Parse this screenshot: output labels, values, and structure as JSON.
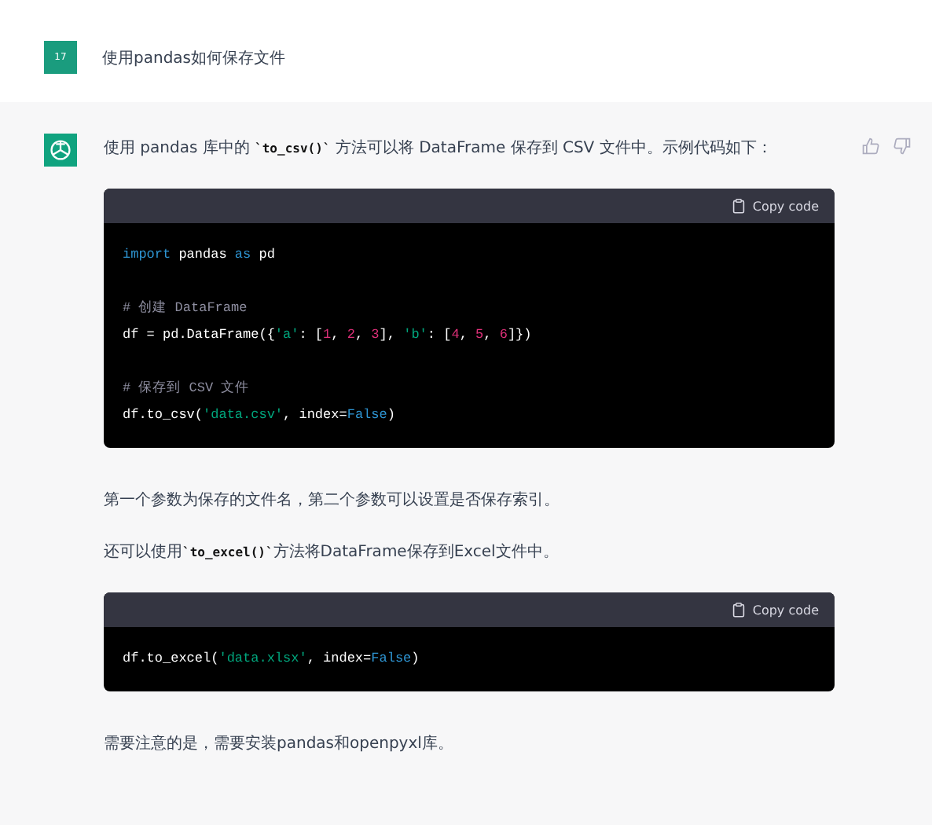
{
  "user_message": {
    "avatar": "17",
    "text": "使用pandas如何保存文件"
  },
  "answer": {
    "blocks": [
      {
        "kind": "paragraph",
        "segments": [
          {
            "kind": "text",
            "text": "使用 pandas 库中的 "
          },
          {
            "kind": "code",
            "text": "`to_csv()`"
          },
          {
            "kind": "text",
            "text": " 方法可以将 DataFrame 保存到 CSV 文件中。示例代码如下："
          }
        ]
      },
      {
        "kind": "code",
        "button": "Copy code",
        "groups": [
          [
            [
              {
                "kind": "keyword",
                "text": "import"
              },
              {
                "kind": "plain",
                "text": " pandas "
              },
              {
                "kind": "keyword",
                "text": "as"
              },
              {
                "kind": "plain",
                "text": " pd"
              }
            ]
          ],
          [
            [
              {
                "kind": "comment",
                "text": "# 创建 DataFrame"
              }
            ],
            [
              {
                "kind": "plain",
                "text": "df = pd.DataFrame({"
              },
              {
                "kind": "string",
                "text": "'a'"
              },
              {
                "kind": "plain",
                "text": ": ["
              },
              {
                "kind": "number",
                "text": "1"
              },
              {
                "kind": "plain",
                "text": ", "
              },
              {
                "kind": "number",
                "text": "2"
              },
              {
                "kind": "plain",
                "text": ", "
              },
              {
                "kind": "number",
                "text": "3"
              },
              {
                "kind": "plain",
                "text": "], "
              },
              {
                "kind": "string",
                "text": "'b'"
              },
              {
                "kind": "plain",
                "text": ": ["
              },
              {
                "kind": "number",
                "text": "4"
              },
              {
                "kind": "plain",
                "text": ", "
              },
              {
                "kind": "number",
                "text": "5"
              },
              {
                "kind": "plain",
                "text": ", "
              },
              {
                "kind": "number",
                "text": "6"
              },
              {
                "kind": "plain",
                "text": "]})"
              }
            ]
          ],
          [
            [
              {
                "kind": "comment",
                "text": "# 保存到 CSV 文件"
              }
            ],
            [
              {
                "kind": "plain",
                "text": "df.to_csv("
              },
              {
                "kind": "string",
                "text": "'data.csv'"
              },
              {
                "kind": "plain",
                "text": ", index="
              },
              {
                "kind": "keyword",
                "text": "False"
              },
              {
                "kind": "plain",
                "text": ")"
              }
            ]
          ]
        ]
      },
      {
        "kind": "paragraph",
        "segments": [
          {
            "kind": "text",
            "text": "第一个参数为保存的文件名，第二个参数可以设置是否保存索引。"
          }
        ]
      },
      {
        "kind": "paragraph",
        "segments": [
          {
            "kind": "text",
            "text": "还可以使用"
          },
          {
            "kind": "code",
            "text": "`to_excel()`"
          },
          {
            "kind": "text",
            "text": "方法将DataFrame保存到Excel文件中。"
          }
        ]
      },
      {
        "kind": "code",
        "button": "Copy code",
        "groups": [
          [
            [
              {
                "kind": "plain",
                "text": "df.to_excel("
              },
              {
                "kind": "string",
                "text": "'data.xlsx'"
              },
              {
                "kind": "plain",
                "text": ", index="
              },
              {
                "kind": "keyword",
                "text": "False"
              },
              {
                "kind": "plain",
                "text": ")"
              }
            ]
          ]
        ]
      },
      {
        "kind": "paragraph",
        "segments": [
          {
            "kind": "text",
            "text": "需要注意的是，需要安装pandas和openpyxl库。"
          }
        ]
      }
    ]
  }
}
